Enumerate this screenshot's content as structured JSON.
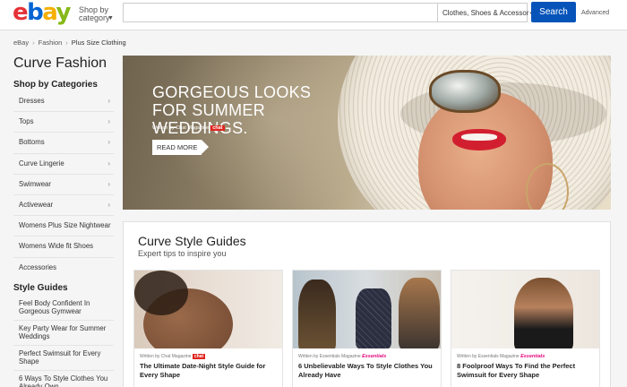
{
  "header": {
    "logo": {
      "e": "e",
      "b": "b",
      "a": "a",
      "y": "y"
    },
    "shop_by_line1": "Shop by",
    "shop_by_line2": "category",
    "search_placeholder": "",
    "category_select": "Clothes, Shoes & Accessor",
    "search_button": "Search",
    "advanced": "Advanced"
  },
  "breadcrumb": [
    "eBay",
    "Fashion",
    "Plus Size Clothing"
  ],
  "sidebar": {
    "title": "Curve Fashion",
    "categories_heading": "Shop by Categories",
    "categories": [
      {
        "label": "Dresses",
        "chevron": true
      },
      {
        "label": "Tops",
        "chevron": true
      },
      {
        "label": "Bottoms",
        "chevron": true
      },
      {
        "label": "Curve Lingerie",
        "chevron": true
      },
      {
        "label": "Swimwear",
        "chevron": true
      },
      {
        "label": "Activewear",
        "chevron": true
      },
      {
        "label": "Womens Plus Size Nightwear",
        "chevron": false
      },
      {
        "label": "Womens Wide fit Shoes",
        "chevron": false
      },
      {
        "label": "Accessories",
        "chevron": false
      }
    ],
    "guides_heading": "Style Guides",
    "guides": [
      "Feel Body Confident In Gorgeous Gymwear",
      "Key Party Wear for Summer Weddings",
      "Perfect Swimsuit for Every Shape",
      "6 Ways To Style Clothes You Already Own"
    ]
  },
  "hero": {
    "title": "GORGEOUS LOOKS FOR SUMMER WEDDINGS.",
    "byline": "Written by Chat Magazine",
    "badge": "chat",
    "cta": "READ MORE"
  },
  "guides_panel": {
    "title": "Curve Style Guides",
    "subtitle": "Expert tips to inspire you",
    "cards": [
      {
        "byline": "Written by Chat Magazine",
        "badge": "chat",
        "badge_type": "chef",
        "title": "The Ultimate Date-Night Style Guide for Every Shape"
      },
      {
        "byline": "Written by Essentials Magazine",
        "badge": "Essentials",
        "badge_type": "ess",
        "title": "6 Unbelievable Ways To Style Clothes You Already Have"
      },
      {
        "byline": "Written by Essentials Magazine",
        "badge": "Essentials",
        "badge_type": "ess",
        "title": "8 Foolproof Ways To Find the Perfect Swimsuit for Every Shape"
      }
    ]
  },
  "colors": {
    "accent_blue": "#0654ba",
    "logo_red": "#e53238",
    "logo_blue": "#0064d2",
    "logo_yellow": "#f5af02",
    "logo_green": "#86b817",
    "chat_badge": "#e0251c",
    "essentials_badge": "#e4067e"
  }
}
